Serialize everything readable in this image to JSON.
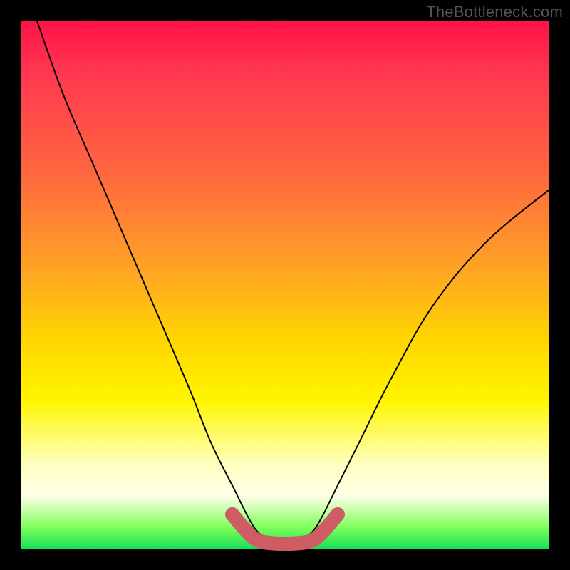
{
  "watermark": "TheBottleneck.com",
  "chart_data": {
    "type": "line",
    "title": "",
    "xlabel": "",
    "ylabel": "",
    "xlim": [
      0,
      100
    ],
    "ylim": [
      0,
      100
    ],
    "series": [
      {
        "name": "black-curve",
        "color": "#000000",
        "stroke_width": 2,
        "x": [
          3,
          8,
          14,
          20,
          26,
          32,
          36,
          40,
          43,
          45,
          48,
          52,
          55,
          57,
          60,
          64,
          70,
          78,
          88,
          100
        ],
        "y": [
          100,
          86,
          72,
          58,
          44,
          30,
          20,
          12,
          6,
          3,
          1,
          1,
          3,
          6,
          12,
          20,
          32,
          46,
          58,
          68
        ]
      },
      {
        "name": "pink-band",
        "color": "#cd5c64",
        "stroke_width": 20,
        "x": [
          40,
          43,
          45,
          48,
          52,
          55,
          57,
          60
        ],
        "y": [
          6.5,
          3,
          1.5,
          1,
          1,
          1.5,
          3,
          6.5
        ]
      }
    ]
  }
}
